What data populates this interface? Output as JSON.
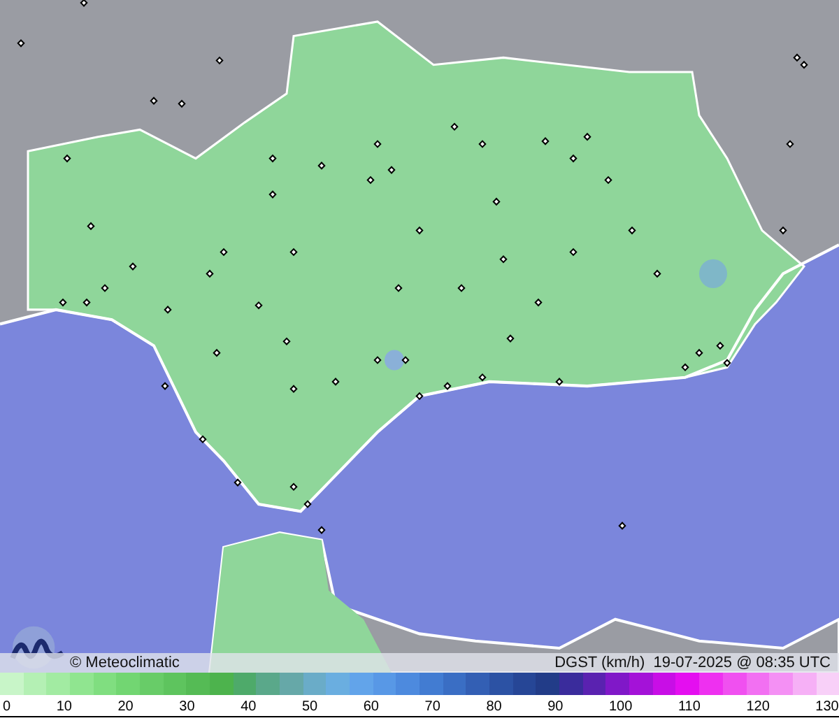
{
  "credit": "© Meteoclimatic",
  "caption": "DGST (km/h)  19-07-2025 @ 08:35 UTC",
  "scale": {
    "ticks": [
      "0",
      "10",
      "20",
      "30",
      "40",
      "50",
      "60",
      "70",
      "80",
      "90",
      "100",
      "110",
      "120",
      "130"
    ]
  }
}
